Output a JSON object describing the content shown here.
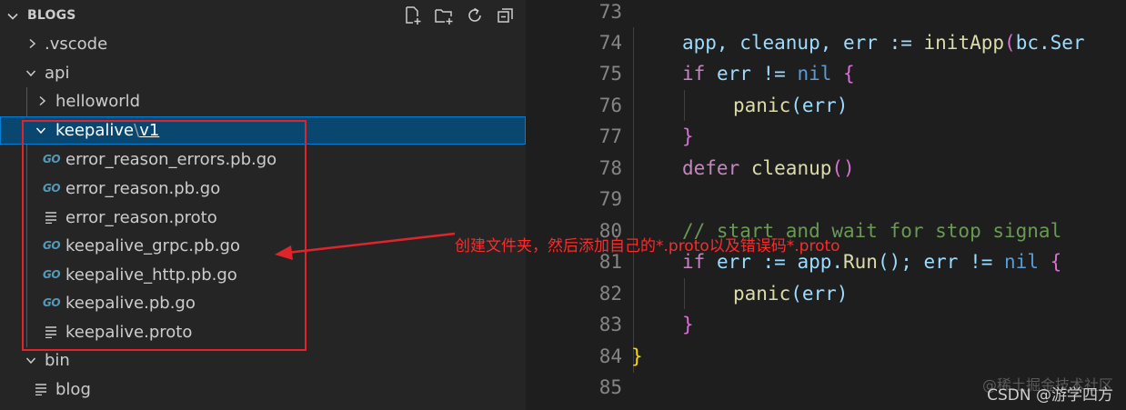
{
  "explorer": {
    "title": "BLOGS",
    "tree": [
      {
        "label": ".vscode",
        "kind": "folder",
        "expanded": false
      },
      {
        "label": "api",
        "kind": "folder",
        "expanded": true
      },
      {
        "label": "helloworld",
        "kind": "folder",
        "expanded": false
      },
      {
        "label": "keepalive",
        "sep": "\\",
        "label2": "v1",
        "kind": "folder",
        "expanded": true,
        "selected": true
      },
      {
        "label": "error_reason_errors.pb.go",
        "kind": "go"
      },
      {
        "label": "error_reason.pb.go",
        "kind": "go"
      },
      {
        "label": "error_reason.proto",
        "kind": "proto"
      },
      {
        "label": "keepalive_grpc.pb.go",
        "kind": "go"
      },
      {
        "label": "keepalive_http.pb.go",
        "kind": "go"
      },
      {
        "label": "keepalive.pb.go",
        "kind": "go"
      },
      {
        "label": "keepalive.proto",
        "kind": "proto"
      },
      {
        "label": "bin",
        "kind": "folder",
        "expanded": true
      },
      {
        "label": "blog",
        "kind": "proto"
      }
    ],
    "go_icon_text": "GO"
  },
  "editor": {
    "line_numbers": [
      "73",
      "74",
      "75",
      "76",
      "77",
      "78",
      "79",
      "80",
      "81",
      "82",
      "83",
      "84",
      "85"
    ],
    "code": {
      "l74": [
        "app, cleanup, err := ",
        "initApp",
        "(",
        "bc.Ser"
      ],
      "l75": [
        "if",
        " err != ",
        "nil",
        " {"
      ],
      "l76": [
        "panic",
        "(err)"
      ],
      "l77": "}",
      "l78": [
        "defer",
        " ",
        "cleanup",
        "()"
      ],
      "l80": "// start and wait for stop signal",
      "l81": [
        "if",
        " err := app.",
        "Run",
        "(); err != ",
        "nil",
        " {"
      ],
      "l82": [
        "panic",
        "(err)"
      ],
      "l83": "}",
      "l84": "}"
    }
  },
  "annotation": {
    "text": "创建文件夹，然后添加自己的*.proto以及错误码*.proto",
    "color": "#ff2a2a"
  },
  "watermark": {
    "main": "CSDN @游学四方",
    "faint": "@稀土掘金技术社区"
  }
}
